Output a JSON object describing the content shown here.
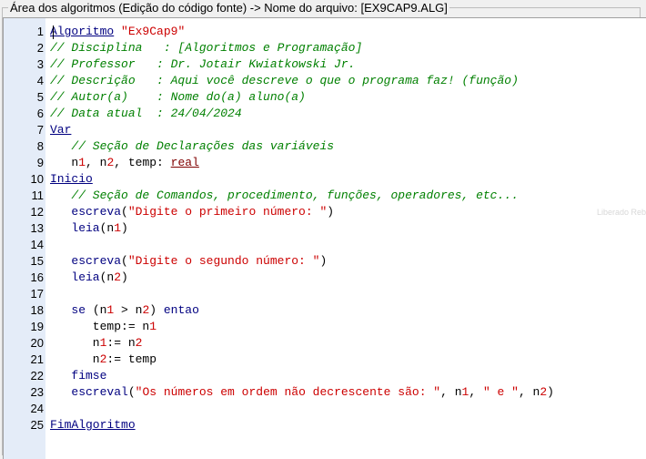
{
  "panel": {
    "title": "Área dos algoritmos (Edição do código fonte) -> Nome do arquivo: [EX9CAP9.ALG]"
  },
  "ghost_text": "Liberado Rebuilt",
  "lines": [
    {
      "n": "1",
      "tokens": [
        {
          "t": "kw",
          "v": "Algoritmo"
        },
        {
          "t": "op",
          "v": " "
        },
        {
          "t": "str",
          "v": "\"Ex9Cap9\""
        }
      ]
    },
    {
      "n": "2",
      "tokens": [
        {
          "t": "cm",
          "v": "// Disciplina   : [Algoritmos e Programação]"
        }
      ]
    },
    {
      "n": "3",
      "tokens": [
        {
          "t": "cm",
          "v": "// Professor   : Dr. Jotair Kwiatkowski Jr."
        }
      ]
    },
    {
      "n": "4",
      "tokens": [
        {
          "t": "cm",
          "v": "// Descrição   : Aqui você descreve o que o programa faz! (função)"
        }
      ]
    },
    {
      "n": "5",
      "tokens": [
        {
          "t": "cm",
          "v": "// Autor(a)    : Nome do(a) aluno(a)"
        }
      ]
    },
    {
      "n": "6",
      "tokens": [
        {
          "t": "cm",
          "v": "// Data atual  : 24/04/2024"
        }
      ]
    },
    {
      "n": "7",
      "tokens": [
        {
          "t": "kw",
          "v": "Var"
        }
      ]
    },
    {
      "n": "8",
      "tokens": [
        {
          "t": "cm",
          "v": "   // Seção de Declarações das variáveis"
        }
      ]
    },
    {
      "n": "9",
      "tokens": [
        {
          "t": "id",
          "v": "   n"
        },
        {
          "t": "num",
          "v": "1"
        },
        {
          "t": "id",
          "v": ", n"
        },
        {
          "t": "num",
          "v": "2"
        },
        {
          "t": "id",
          "v": ", temp: "
        },
        {
          "t": "type",
          "v": "real"
        }
      ]
    },
    {
      "n": "10",
      "tokens": [
        {
          "t": "kw",
          "v": "Inicio"
        }
      ]
    },
    {
      "n": "11",
      "tokens": [
        {
          "t": "cm",
          "v": "   // Seção de Comandos, procedimento, funções, operadores, etc..."
        }
      ]
    },
    {
      "n": "12",
      "tokens": [
        {
          "t": "op",
          "v": "   "
        },
        {
          "t": "fn",
          "v": "escreva"
        },
        {
          "t": "op",
          "v": "("
        },
        {
          "t": "str",
          "v": "\"Digite o primeiro número: \""
        },
        {
          "t": "op",
          "v": ")"
        }
      ]
    },
    {
      "n": "13",
      "tokens": [
        {
          "t": "op",
          "v": "   "
        },
        {
          "t": "fn",
          "v": "leia"
        },
        {
          "t": "op",
          "v": "(n"
        },
        {
          "t": "num",
          "v": "1"
        },
        {
          "t": "op",
          "v": ")"
        }
      ]
    },
    {
      "n": "14",
      "tokens": []
    },
    {
      "n": "15",
      "tokens": [
        {
          "t": "op",
          "v": "   "
        },
        {
          "t": "fn",
          "v": "escreva"
        },
        {
          "t": "op",
          "v": "("
        },
        {
          "t": "str",
          "v": "\"Digite o segundo número: \""
        },
        {
          "t": "op",
          "v": ")"
        }
      ]
    },
    {
      "n": "16",
      "tokens": [
        {
          "t": "op",
          "v": "   "
        },
        {
          "t": "fn",
          "v": "leia"
        },
        {
          "t": "op",
          "v": "(n"
        },
        {
          "t": "num",
          "v": "2"
        },
        {
          "t": "op",
          "v": ")"
        }
      ]
    },
    {
      "n": "17",
      "tokens": []
    },
    {
      "n": "18",
      "tokens": [
        {
          "t": "op",
          "v": "   "
        },
        {
          "t": "fn",
          "v": "se"
        },
        {
          "t": "op",
          "v": " (n"
        },
        {
          "t": "num",
          "v": "1"
        },
        {
          "t": "op",
          "v": " > n"
        },
        {
          "t": "num",
          "v": "2"
        },
        {
          "t": "op",
          "v": ") "
        },
        {
          "t": "fn",
          "v": "entao"
        }
      ]
    },
    {
      "n": "19",
      "tokens": [
        {
          "t": "op",
          "v": "      temp:= n"
        },
        {
          "t": "num",
          "v": "1"
        }
      ]
    },
    {
      "n": "20",
      "tokens": [
        {
          "t": "op",
          "v": "      n"
        },
        {
          "t": "num",
          "v": "1"
        },
        {
          "t": "op",
          "v": ":= n"
        },
        {
          "t": "num",
          "v": "2"
        }
      ]
    },
    {
      "n": "21",
      "tokens": [
        {
          "t": "op",
          "v": "      n"
        },
        {
          "t": "num",
          "v": "2"
        },
        {
          "t": "op",
          "v": ":= temp"
        }
      ]
    },
    {
      "n": "22",
      "tokens": [
        {
          "t": "op",
          "v": "   "
        },
        {
          "t": "fn",
          "v": "fimse"
        }
      ]
    },
    {
      "n": "23",
      "tokens": [
        {
          "t": "op",
          "v": "   "
        },
        {
          "t": "fn",
          "v": "escreval"
        },
        {
          "t": "op",
          "v": "("
        },
        {
          "t": "str",
          "v": "\"Os números em ordem não decrescente são: \""
        },
        {
          "t": "op",
          "v": ", n"
        },
        {
          "t": "num",
          "v": "1"
        },
        {
          "t": "op",
          "v": ", "
        },
        {
          "t": "str",
          "v": "\" e \""
        },
        {
          "t": "op",
          "v": ", n"
        },
        {
          "t": "num",
          "v": "2"
        },
        {
          "t": "op",
          "v": ")"
        }
      ]
    },
    {
      "n": "24",
      "tokens": []
    },
    {
      "n": "25",
      "tokens": [
        {
          "t": "kw",
          "v": "FimAlgoritmo"
        }
      ]
    }
  ]
}
